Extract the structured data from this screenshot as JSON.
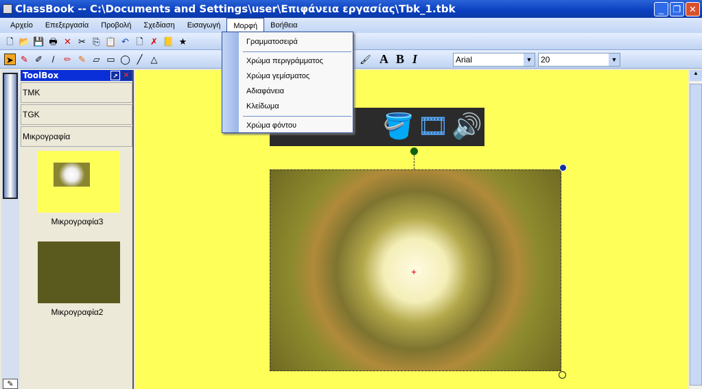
{
  "window": {
    "title": "ClassBook -- C:\\Documents and Settings\\user\\Επιφάνεια εργασίας\\Tbk_1.tbk"
  },
  "menubar": [
    "Αρχείο",
    "Επεξεργασία",
    "Προβολή",
    "Σχεδίαση",
    "Εισαγωγή",
    "Μορφή",
    "Βοήθεια"
  ],
  "format_menu": {
    "items": [
      "Γραμματοσειρά",
      "Χρώμα περιγράμματος",
      "Χρώμα γεμίσματος",
      "Αδιαφάνεια",
      "Κλείδωμα",
      "Χρώμα φόντου"
    ]
  },
  "font_toolbar": {
    "bold": "A",
    "bold2": "B",
    "italic": "I",
    "font": "Arial",
    "size": "20"
  },
  "toolbox": {
    "title": "ToolBox",
    "sections": [
      "TMK",
      "TGK",
      "Μικρογραφία"
    ],
    "thumbnails": [
      "Μικρογραφία3",
      "Μικρογραφία2"
    ]
  },
  "colors": {
    "canvas": "#ffff5a",
    "titlebar": "#0a3fbf"
  }
}
